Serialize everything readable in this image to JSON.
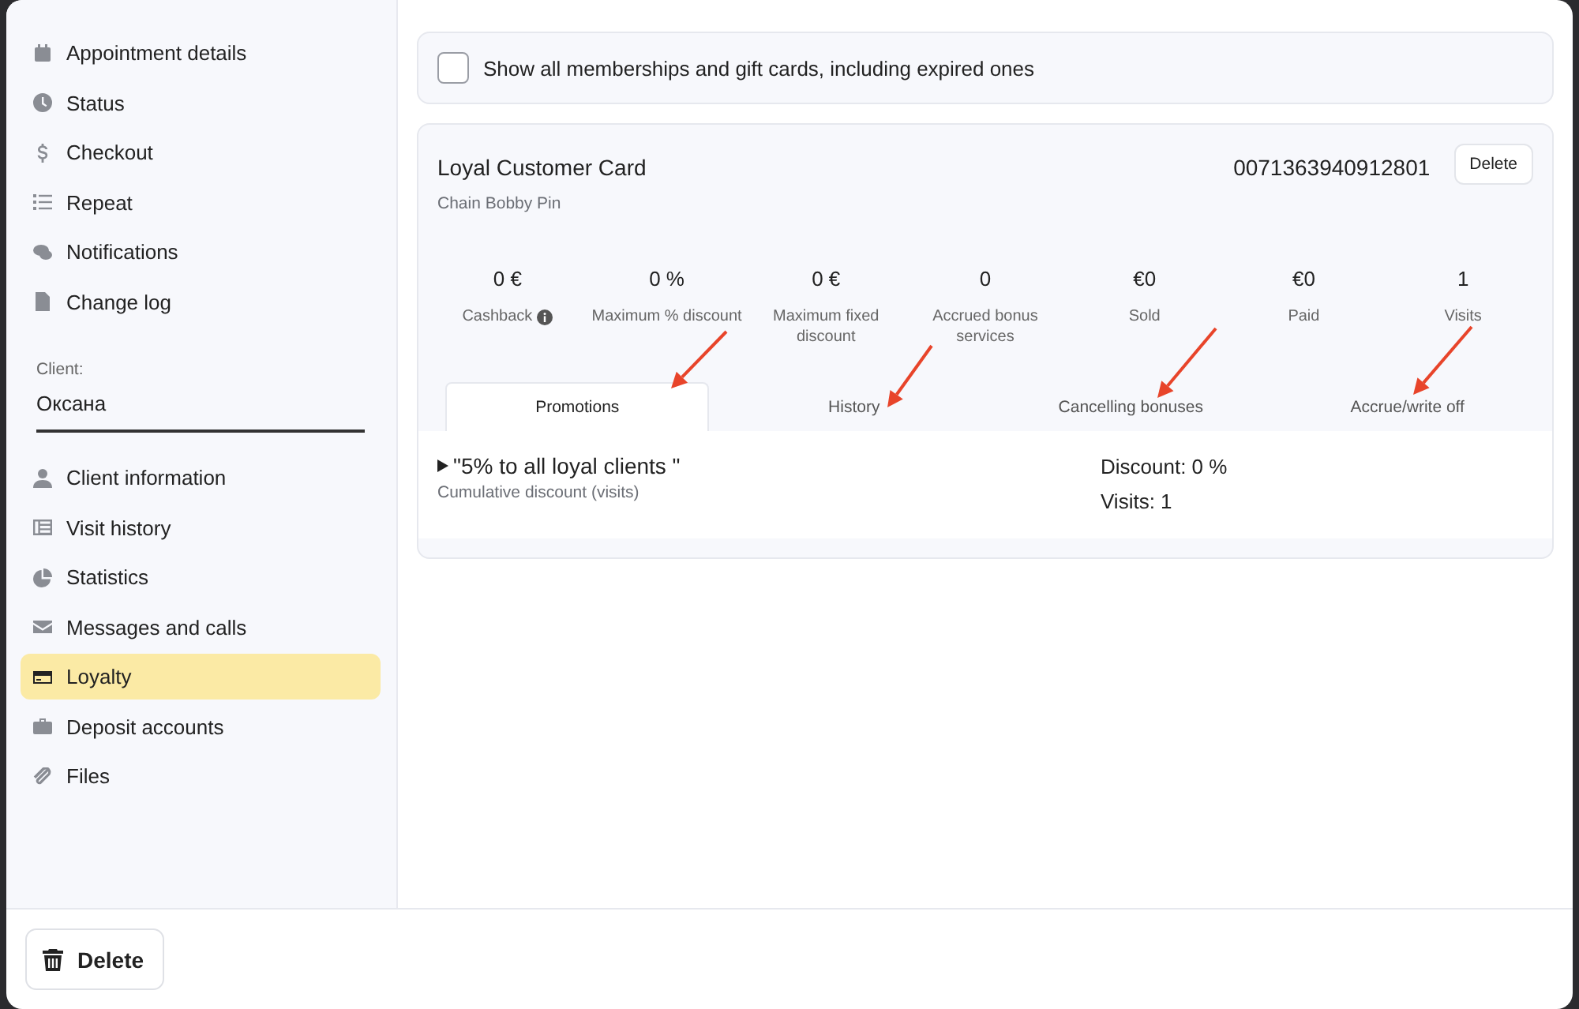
{
  "sidebar": {
    "top_items": [
      {
        "label": "Appointment details",
        "selected": false
      },
      {
        "label": "Status",
        "selected": false
      },
      {
        "label": "Checkout",
        "selected": false
      },
      {
        "label": "Repeat",
        "selected": false
      },
      {
        "label": "Notifications",
        "selected": false
      },
      {
        "label": "Change log",
        "selected": false
      }
    ],
    "client": {
      "label": "Client:",
      "value": "Оксана"
    },
    "client_items": [
      {
        "label": "Client information",
        "selected": false
      },
      {
        "label": "Visit history",
        "selected": false
      },
      {
        "label": "Statistics",
        "selected": false
      },
      {
        "label": "Messages and calls",
        "selected": false
      },
      {
        "label": "Loyalty",
        "selected": true
      },
      {
        "label": "Deposit accounts",
        "selected": false
      },
      {
        "label": "Files",
        "selected": false
      }
    ]
  },
  "filter": {
    "label": "Show all memberships and gift cards, including expired ones",
    "checked": false
  },
  "card": {
    "title": "Loyal Customer Card",
    "subtitle": "Chain Bobby Pin",
    "number": "0071363940912801",
    "delete_label": "Delete",
    "stats": [
      {
        "value": "0  €",
        "label": "Cashback",
        "info": true
      },
      {
        "value": "0 %",
        "label": "Maximum % discount",
        "info": false
      },
      {
        "value": "0 €",
        "label": "Maximum fixed discount",
        "info": false
      },
      {
        "value": "0",
        "label": "Accrued bonus services",
        "info": false
      },
      {
        "value": "€0",
        "label": "Sold",
        "info": false
      },
      {
        "value": "€0",
        "label": "Paid",
        "info": false
      },
      {
        "value": "1",
        "label": "Visits",
        "info": false
      }
    ],
    "tabs": [
      {
        "label": "Promotions",
        "selected": true
      },
      {
        "label": "History",
        "selected": false
      },
      {
        "label": "Cancelling bonuses",
        "selected": false
      },
      {
        "label": "Accrue/write off",
        "selected": false
      }
    ],
    "promotions": [
      {
        "name": "\"5% to all loyal clients \"",
        "type": "Cumulative discount (visits)",
        "expanded": false,
        "details": [
          "Discount: 0 %",
          "Visits: 1"
        ]
      }
    ]
  },
  "footer": {
    "delete_label": "Delete"
  }
}
